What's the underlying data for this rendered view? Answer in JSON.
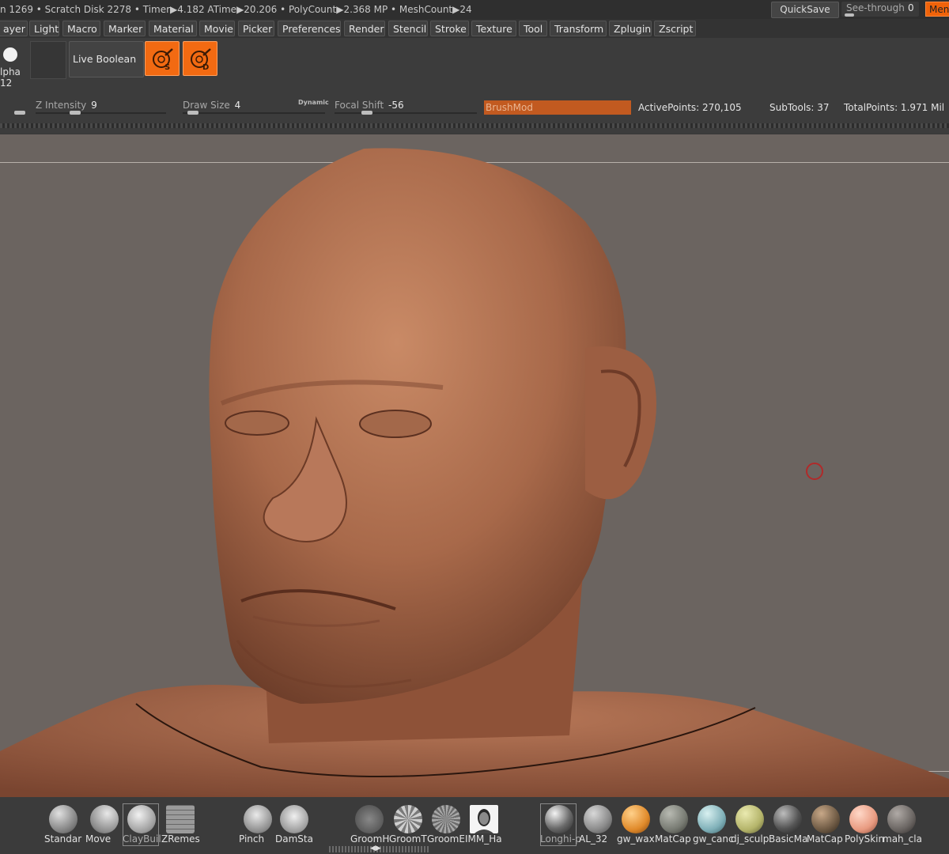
{
  "status_bar": {
    "text": "n 1269 • Scratch Disk 2278 •  Timer▶4.182 ATime▶20.206 • PolyCount▶2.368 MP • MeshCount▶24"
  },
  "top_right": {
    "quicksave_label": "QuickSave",
    "seethrough_label": "See-through",
    "seethrough_value": "0",
    "menus_label": "Men"
  },
  "menus": [
    "ayer",
    "Light",
    "Macro",
    "Marker",
    "Material",
    "Movie",
    "Picker",
    "Preferences",
    "Render",
    "Stencil",
    "Stroke",
    "Texture",
    "Tool",
    "Transform",
    "Zplugin",
    "Zscript"
  ],
  "shelf": {
    "alpha_label": "lpha 12",
    "live_boolean_label": "Live Boolean",
    "solo_icon": "solo-mode-icon",
    "dynamic_icon": "dynamic-mode-icon",
    "solo_letter": "S",
    "dynamic_letter": "D",
    "accent": "#f26a12"
  },
  "sliders": {
    "z_intensity": {
      "label": "Z Intensity",
      "value": "9"
    },
    "draw_size": {
      "label": "Draw Size",
      "value": "4",
      "dynamic_label": "Dynamic"
    },
    "focal_shift": {
      "label": "Focal Shift",
      "value": "-56"
    },
    "brushmod_label": "BrushMod"
  },
  "stats": {
    "active_points": "ActivePoints: 270,105",
    "subtools": "SubTools: 37",
    "total_points": "TotalPoints: 1.971 Mil"
  },
  "brushes": [
    {
      "label": "Standar",
      "icon": "standard-brush-icon"
    },
    {
      "label": "Move",
      "icon": "move-brush-icon"
    },
    {
      "label": "ClayBuil",
      "icon": "claybuildup-brush-icon",
      "selected": true
    },
    {
      "label": "ZRemes",
      "icon": "zremesher-icon"
    },
    {
      "label": "Pinch",
      "icon": "pinch-brush-icon"
    },
    {
      "label": "DamSta",
      "icon": "damstandard-brush-icon"
    },
    {
      "label": "GroomH",
      "icon": "groom-hair-brush-icon"
    },
    {
      "label": "GroomT",
      "icon": "groom-turbulence-brush-icon"
    },
    {
      "label": "GroomE",
      "icon": "groom-brush-icon"
    },
    {
      "label": "IMM_Ha",
      "icon": "imm-head-brush-icon"
    }
  ],
  "materials": [
    {
      "label": "Longhi-p",
      "color": "#6a6a6a",
      "selected": true
    },
    {
      "label": "AL_32",
      "color": "#9a9a9a"
    },
    {
      "label": "gw_wax",
      "color": "#e08a2a"
    },
    {
      "label": "MatCap",
      "color": "#777a72"
    },
    {
      "label": "gw_canc",
      "color": "#7fb0b8"
    },
    {
      "label": "dj_sculp",
      "color": "#b4b46a"
    },
    {
      "label": "BasicMa",
      "color": "#555555"
    },
    {
      "label": "MatCap",
      "color": "#6e5a44"
    },
    {
      "label": "PolySkin",
      "color": "#e89a80"
    },
    {
      "label": "mah_cla",
      "color": "#6a6562"
    }
  ]
}
